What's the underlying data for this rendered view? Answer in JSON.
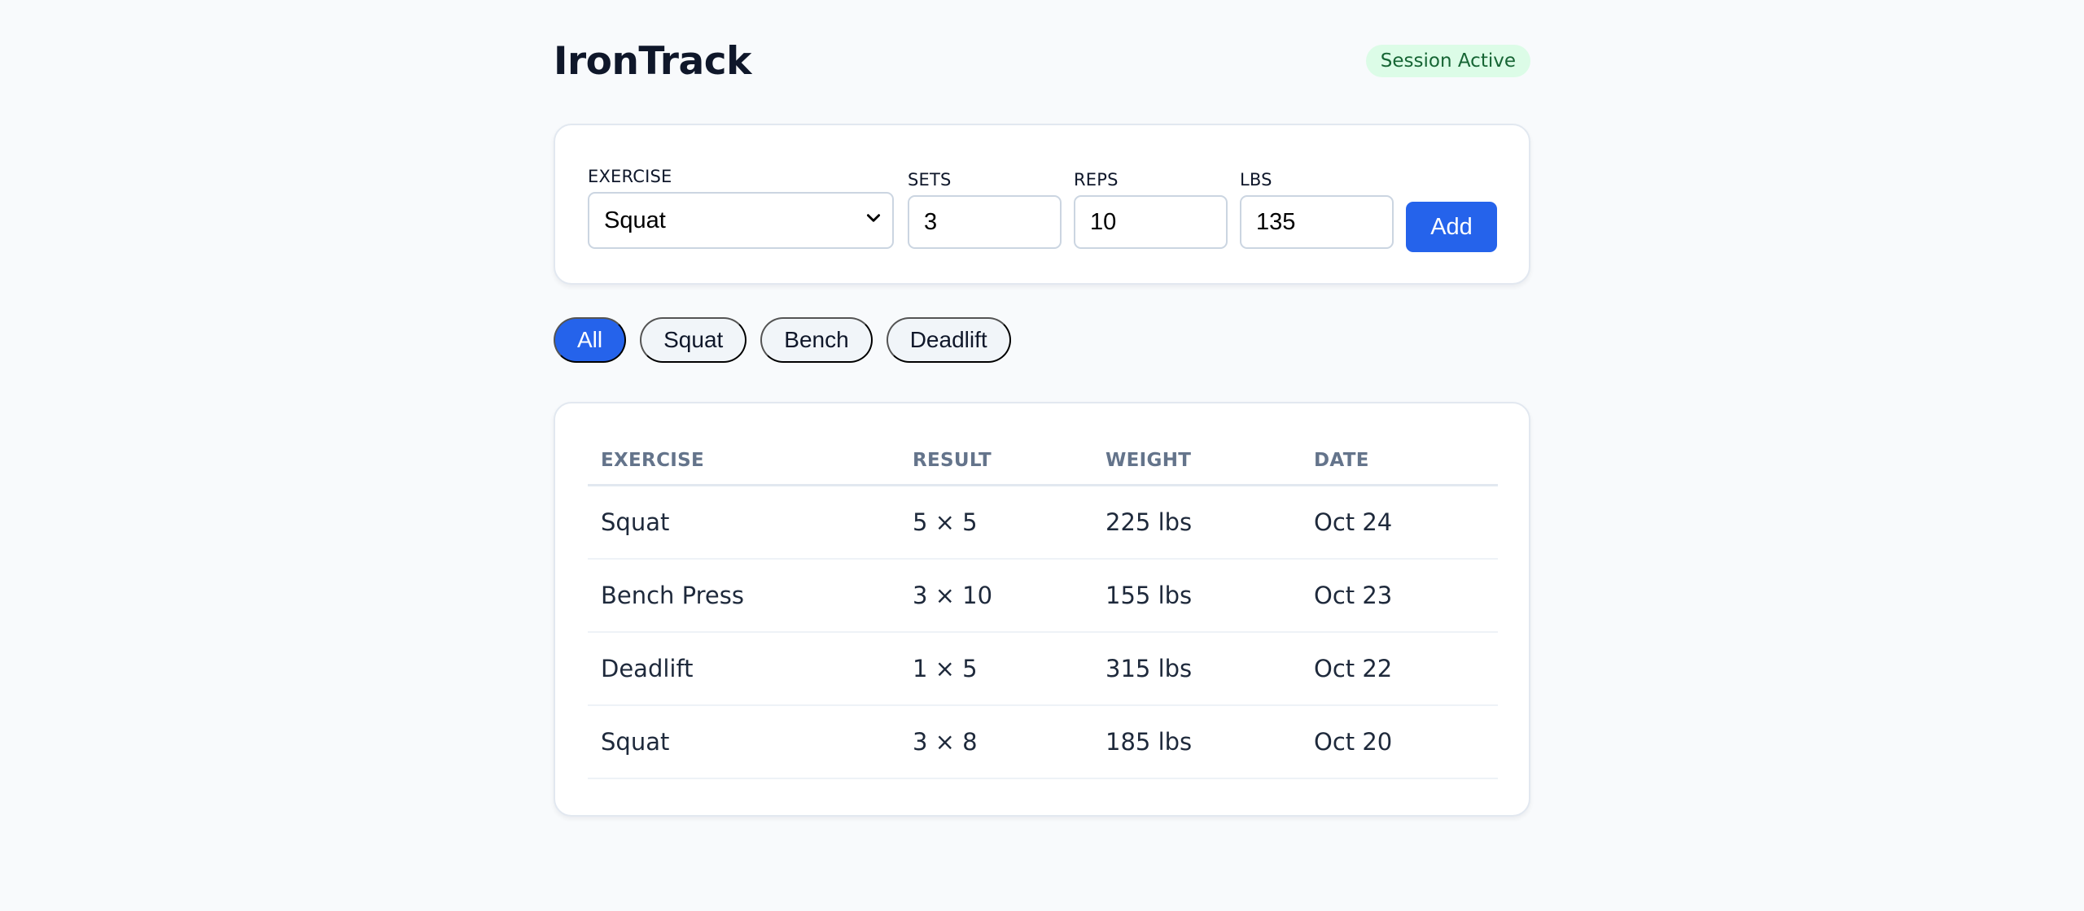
{
  "app": {
    "title": "IronTrack",
    "status_badge": "Session Active"
  },
  "form": {
    "exercise_label": "EXERCISE",
    "exercise_value": "Squat",
    "sets_label": "SETS",
    "sets_value": "3",
    "reps_label": "REPS",
    "reps_value": "10",
    "lbs_label": "LBS",
    "lbs_value": "135",
    "add_label": "Add"
  },
  "filters": [
    {
      "label": "All",
      "active": true
    },
    {
      "label": "Squat",
      "active": false
    },
    {
      "label": "Bench",
      "active": false
    },
    {
      "label": "Deadlift",
      "active": false
    }
  ],
  "table": {
    "headers": [
      "EXERCISE",
      "RESULT",
      "WEIGHT",
      "DATE"
    ],
    "rows": [
      [
        "Squat",
        "5 × 5",
        "225 lbs",
        "Oct 24"
      ],
      [
        "Bench Press",
        "3 × 10",
        "155 lbs",
        "Oct 23"
      ],
      [
        "Deadlift",
        "1 × 5",
        "315 lbs",
        "Oct 22"
      ],
      [
        "Squat",
        "3 × 8",
        "185 lbs",
        "Oct 20"
      ]
    ]
  },
  "colors": {
    "accent": "#2563eb",
    "badge_bg": "#dcfce7",
    "badge_text": "#166534"
  },
  "icons": {
    "select_chevron": "chevron-down-icon"
  }
}
